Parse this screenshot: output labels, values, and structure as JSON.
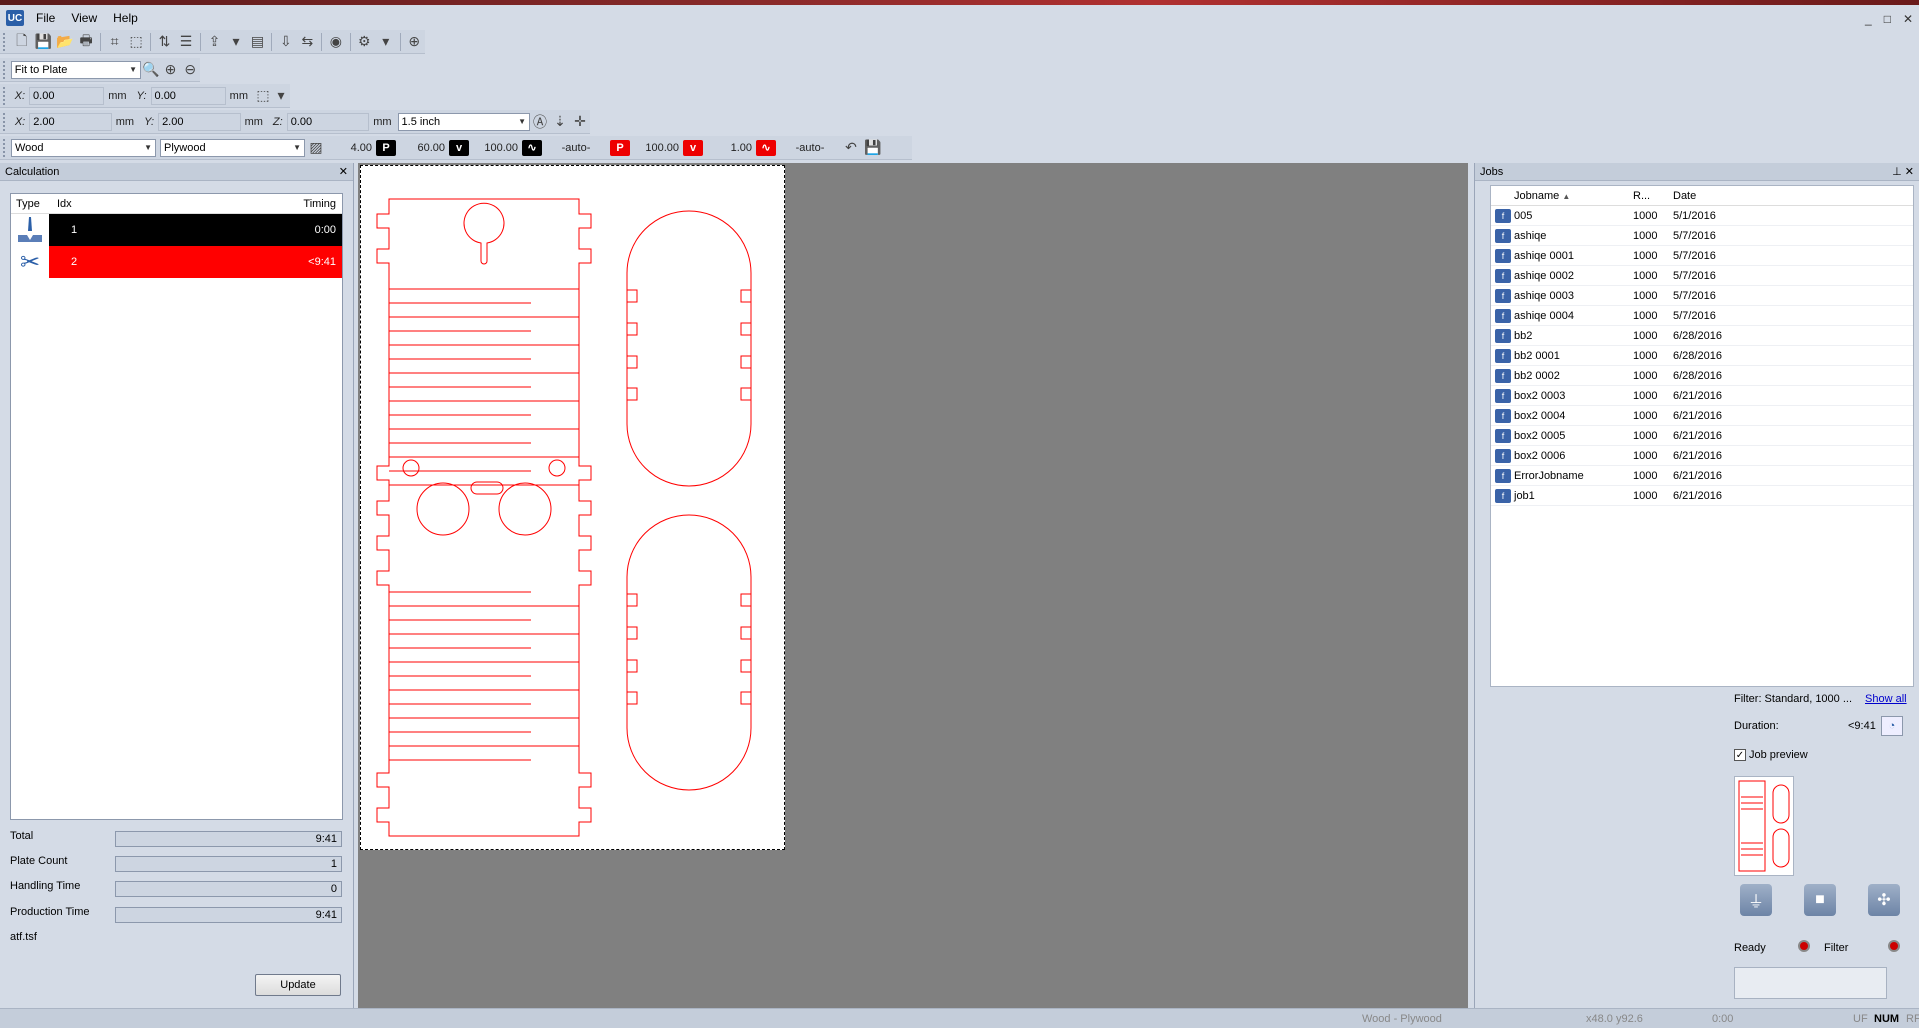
{
  "menu": {
    "file": "File",
    "view": "View",
    "help": "Help"
  },
  "app_icon": "UC",
  "window_controls": [
    "_",
    "□",
    "✕"
  ],
  "zoom": {
    "value": "Fit to Plate"
  },
  "position": {
    "x_label": "X:",
    "x": "0.00",
    "y_label": "Y:",
    "y": "0.00",
    "unit": "mm"
  },
  "size": {
    "x_label": "X:",
    "x": "2.00",
    "y_label": "Y:",
    "y": "2.00",
    "z_label": "Z:",
    "z": "0.00",
    "unit": "mm",
    "thickness": "1.5 inch"
  },
  "material": {
    "group": "Wood",
    "type": "Plywood",
    "hatch": "4.00",
    "p1": "60.00",
    "v1": "100.00",
    "f1": "-auto-",
    "p2": "100.00",
    "v2": "1.00",
    "f2": "-auto-",
    "p_badge": "P",
    "v_badge": "v"
  },
  "calculation": {
    "title": "Calculation",
    "columns": {
      "type": "Type",
      "idx": "Idx",
      "timing": "Timing"
    },
    "rows": [
      {
        "idx": "1",
        "timing": "0:00",
        "color": "#000000"
      },
      {
        "idx": "2",
        "timing": "<9:41",
        "color": "#ff0000"
      }
    ],
    "total_label": "Total",
    "total": "9:41",
    "plate_count_label": "Plate Count",
    "plate_count": "1",
    "handling_label": "Handling Time",
    "handling": "0",
    "production_label": "Production Time",
    "production": "9:41",
    "file": "atf.tsf",
    "update": "Update"
  },
  "jobs": {
    "title": "Jobs",
    "columns": {
      "name": "Jobname",
      "r": "R...",
      "date": "Date"
    },
    "rows": [
      {
        "name": "005",
        "r": "1000",
        "date": "5/1/2016"
      },
      {
        "name": "ashiqe",
        "r": "1000",
        "date": "5/7/2016"
      },
      {
        "name": "ashiqe 0001",
        "r": "1000",
        "date": "5/7/2016"
      },
      {
        "name": "ashiqe 0002",
        "r": "1000",
        "date": "5/7/2016"
      },
      {
        "name": "ashiqe 0003",
        "r": "1000",
        "date": "5/7/2016"
      },
      {
        "name": "ashiqe 0004",
        "r": "1000",
        "date": "5/7/2016"
      },
      {
        "name": "bb2",
        "r": "1000",
        "date": "6/28/2016"
      },
      {
        "name": "bb2 0001",
        "r": "1000",
        "date": "6/28/2016"
      },
      {
        "name": "bb2 0002",
        "r": "1000",
        "date": "6/28/2016"
      },
      {
        "name": "box2 0003",
        "r": "1000",
        "date": "6/21/2016"
      },
      {
        "name": "box2 0004",
        "r": "1000",
        "date": "6/21/2016"
      },
      {
        "name": "box2 0005",
        "r": "1000",
        "date": "6/21/2016"
      },
      {
        "name": "box2 0006",
        "r": "1000",
        "date": "6/21/2016"
      },
      {
        "name": "ErrorJobname",
        "r": "1000",
        "date": "6/21/2016"
      },
      {
        "name": "job1",
        "r": "1000",
        "date": "6/21/2016"
      }
    ],
    "filter": "Filter: Standard, 1000 ...",
    "show_all": "Show all",
    "duration_label": "Duration:",
    "duration": "<9:41",
    "job_preview": "Job preview",
    "ready": "Ready",
    "filter_label": "Filter"
  },
  "status": {
    "material": "Wood - Plywood",
    "coords": "x48.0  y92.6",
    "time": "0:00",
    "uf": "UF",
    "num": "NUM",
    "rf": "RF"
  },
  "colors": {
    "cut": "#ff0000",
    "engrave": "#000000",
    "accent": "#2b5fa8"
  }
}
